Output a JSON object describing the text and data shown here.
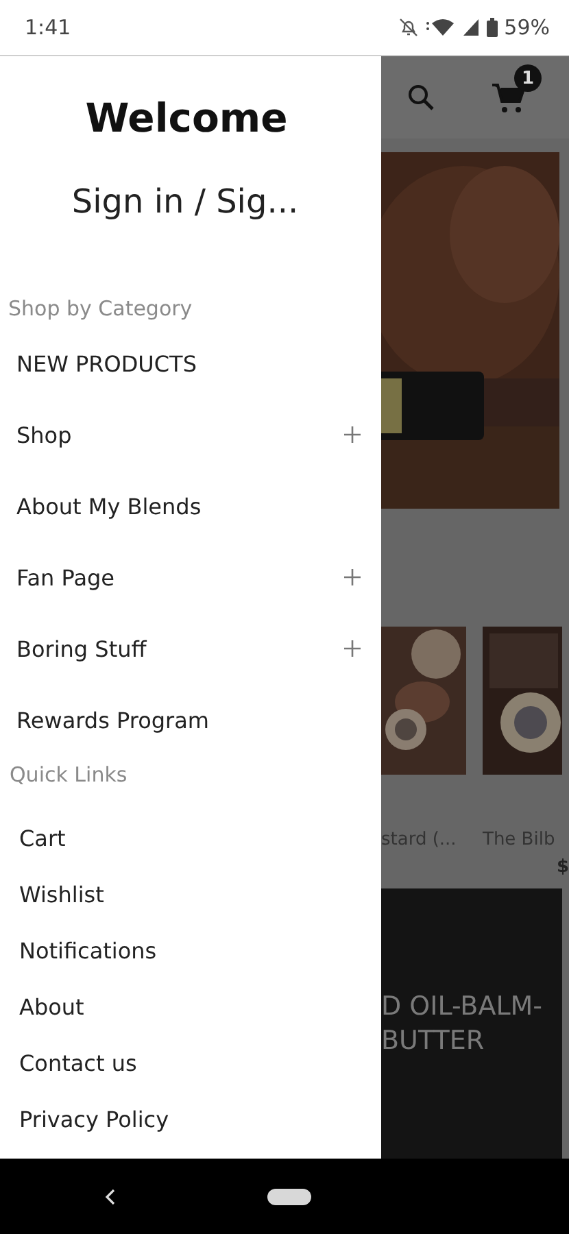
{
  "status_bar": {
    "time": "1:41",
    "battery": "59%"
  },
  "drawer": {
    "title": "Welcome",
    "sign_in": "Sign in / Sig...",
    "sections": [
      {
        "heading": "Shop by Category",
        "kind": "category",
        "items": [
          {
            "label": "NEW PRODUCTS",
            "expandable": false
          },
          {
            "label": "Shop",
            "expandable": true
          },
          {
            "label": "About My Blends",
            "expandable": false
          },
          {
            "label": "Fan Page",
            "expandable": true
          },
          {
            "label": "Boring Stuff",
            "expandable": true
          },
          {
            "label": "Rewards Program",
            "expandable": false
          }
        ]
      },
      {
        "heading": "Quick Links",
        "kind": "link",
        "items": [
          {
            "label": "Cart",
            "expandable": false
          },
          {
            "label": "Wishlist",
            "expandable": false
          },
          {
            "label": "Notifications",
            "expandable": false
          },
          {
            "label": "About",
            "expandable": false
          },
          {
            "label": "Contact us",
            "expandable": false
          },
          {
            "label": "Privacy Policy",
            "expandable": false
          }
        ]
      }
    ]
  },
  "background_app": {
    "cart_count": "1",
    "products": [
      {
        "name": "stard (..."
      },
      {
        "name": "The Bilb",
        "price": "$"
      }
    ],
    "banner_lines": [
      "D OIL-BALM-",
      "BUTTER"
    ]
  }
}
